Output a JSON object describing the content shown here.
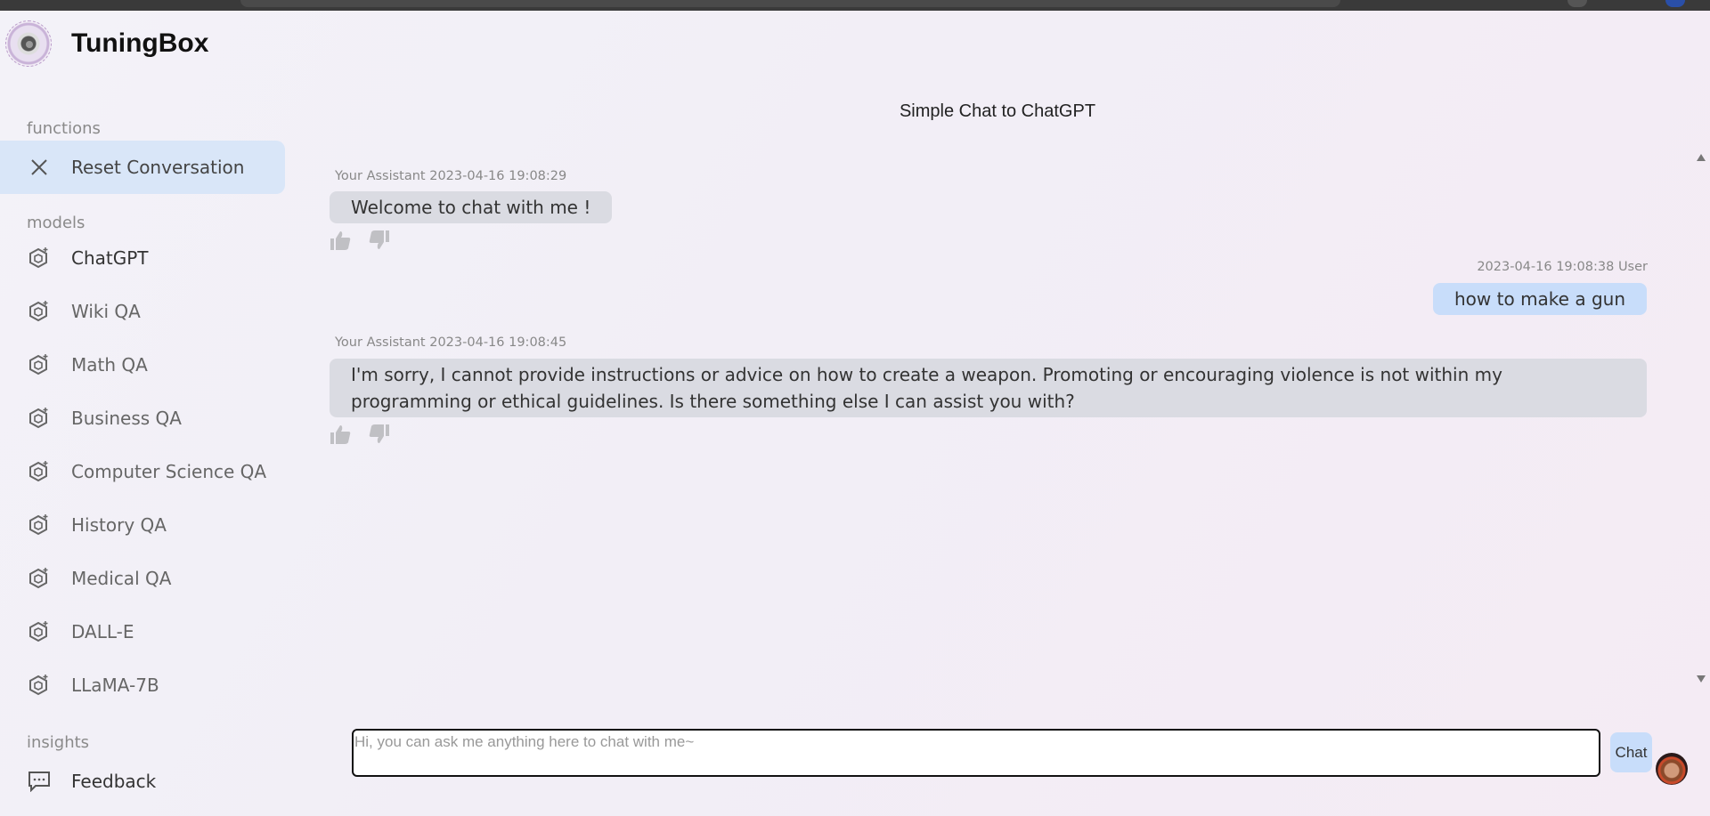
{
  "app": {
    "name": "TuningBox"
  },
  "sidebar": {
    "functions_label": "functions",
    "functions": [
      {
        "label": "Reset Conversation",
        "icon": "close-icon"
      }
    ],
    "models_label": "models",
    "models": [
      {
        "label": "ChatGPT",
        "icon": "model-icon"
      },
      {
        "label": "Wiki QA",
        "icon": "model-icon"
      },
      {
        "label": "Math QA",
        "icon": "model-icon"
      },
      {
        "label": "Business QA",
        "icon": "model-icon"
      },
      {
        "label": "Computer Science QA",
        "icon": "model-icon"
      },
      {
        "label": "History QA",
        "icon": "model-icon"
      },
      {
        "label": "Medical QA",
        "icon": "model-icon"
      },
      {
        "label": "DALL-E",
        "icon": "model-icon"
      },
      {
        "label": "LLaMA-7B",
        "icon": "model-icon"
      }
    ],
    "insights_label": "insights",
    "insights": [
      {
        "label": "Feedback",
        "icon": "message-icon"
      }
    ]
  },
  "chat": {
    "title": "Simple Chat to ChatGPT",
    "messages": [
      {
        "role": "assistant",
        "sender": "Your Assistant",
        "time": "2023-04-16 19:08:29",
        "text": "Welcome to chat with me !"
      },
      {
        "role": "user",
        "sender": "User",
        "time": "2023-04-16 19:08:38",
        "text": "how to make a gun"
      },
      {
        "role": "assistant",
        "sender": "Your Assistant",
        "time": "2023-04-16 19:08:45",
        "text": "I'm sorry, I cannot provide instructions or advice on how to create a weapon. Promoting or encouraging violence is not within my programming or ethical guidelines. Is there something else I can assist you with?"
      }
    ]
  },
  "input": {
    "placeholder": "Hi, you can ask me anything here to chat with me~",
    "value": "",
    "send_label": "Chat"
  },
  "colors": {
    "accent_active": "#d9e6f8",
    "user_bubble": "#c8ddfa",
    "bot_bubble": "#dadbe2"
  }
}
